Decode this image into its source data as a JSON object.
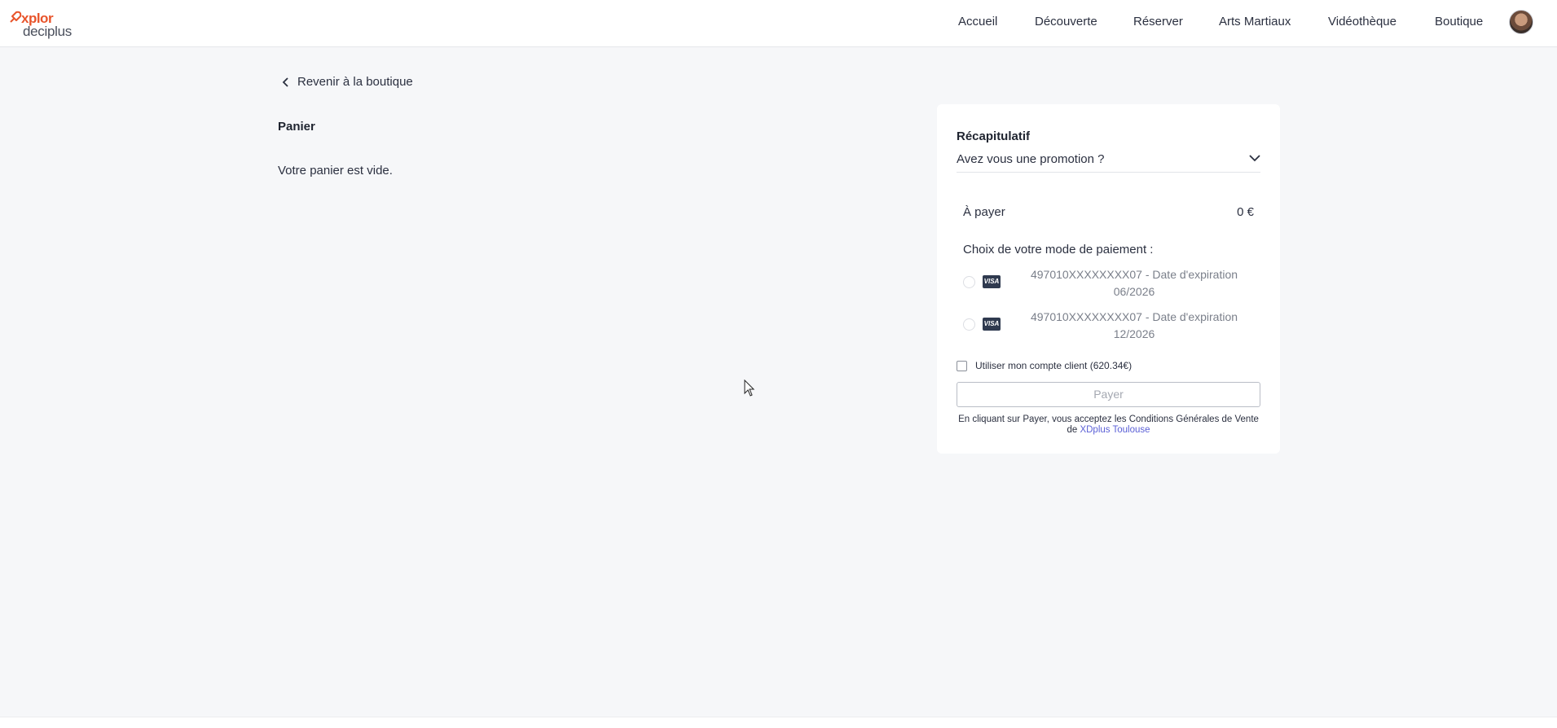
{
  "header": {
    "logo_top": "xplor",
    "logo_bottom": "deciplus",
    "nav": [
      "Accueil",
      "Découverte",
      "Réserver",
      "Arts Martiaux",
      "Vidéothèque",
      "Boutique"
    ]
  },
  "back_link": "Revenir à la boutique",
  "cart": {
    "title": "Panier",
    "empty_message": "Votre panier est vide."
  },
  "summary": {
    "title": "Récapitulatif",
    "promo_label": "Avez vous une promotion ?",
    "to_pay_label": "À payer",
    "to_pay_amount": "0 €",
    "payment_choice_label": "Choix de votre mode de paiement :",
    "payment_methods": [
      {
        "brand": "VISA",
        "line1": "497010XXXXXXXX07 - Date d'expiration",
        "line2": "06/2026"
      },
      {
        "brand": "VISA",
        "line1": "497010XXXXXXXX07 - Date d'expiration",
        "line2": "12/2026"
      }
    ],
    "account_label": "Utiliser mon compte client (620.34€)",
    "pay_button": "Payer",
    "terms_text": "En cliquant sur Payer, vous acceptez les Conditions Générales de Vente de",
    "terms_link": "XDplus Toulouse"
  },
  "colors": {
    "brand": "#e8542b",
    "link": "#5a5fd6",
    "background": "#f6f7f9"
  }
}
